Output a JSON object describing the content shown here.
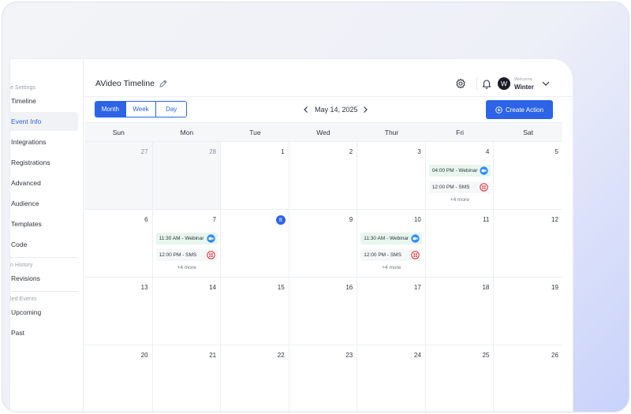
{
  "sidebar": {
    "sections": [
      {
        "label": "e Settings"
      },
      {
        "label": "n History"
      },
      {
        "label": "led Events"
      }
    ],
    "items": [
      {
        "label": "Timeline"
      },
      {
        "label": "Event Info",
        "active": true
      },
      {
        "label": "Integrations"
      },
      {
        "label": "Registrations"
      },
      {
        "label": "Advanced"
      },
      {
        "label": "Audience"
      },
      {
        "label": "Templates"
      },
      {
        "label": "Code"
      },
      {
        "label": "Revisions"
      },
      {
        "label": "Upcoming"
      },
      {
        "label": "Past"
      }
    ]
  },
  "header": {
    "title": "AVideo Timeline",
    "avatar_initial": "W",
    "welcome": "Welcome",
    "username": "Winter"
  },
  "toolbar": {
    "views": [
      "Month",
      "Week",
      "Day"
    ],
    "active_view": "Month",
    "current_date": "May 14, 2025",
    "create_label": "Create Action"
  },
  "calendar": {
    "weekdays": [
      "Sun",
      "Mon",
      "Tue",
      "Wed",
      "Thur",
      "Fri",
      "Sat"
    ],
    "today": "8",
    "weeks": [
      [
        "27",
        "28",
        "1",
        "2",
        "3",
        "4",
        "5"
      ],
      [
        "6",
        "7",
        "8",
        "9",
        "10",
        "11",
        "12"
      ],
      [
        "13",
        "14",
        "15",
        "16",
        "17",
        "18",
        "19"
      ],
      [
        "20",
        "21",
        "22",
        "23",
        "24",
        "25",
        "26"
      ]
    ],
    "events": {
      "webinar_label": "04:00 PM - Webinar",
      "sms_label": "12:00 PM - SMS",
      "webinar_label_b": "11:30 AM - Webinar",
      "more_label": "+4 more"
    }
  },
  "colors": {
    "accent": "#2d63e6",
    "webinar_bg": "#e8f6ee",
    "sms_icon": "#d8343c",
    "zoom_icon": "#2d8cff"
  },
  "icons": [
    "edit-icon",
    "gear-icon",
    "bell-icon",
    "chevron-down-icon",
    "chevron-left-icon",
    "chevron-right-icon",
    "plus-circle-icon",
    "zoom-video-icon",
    "sms-grid-icon"
  ]
}
